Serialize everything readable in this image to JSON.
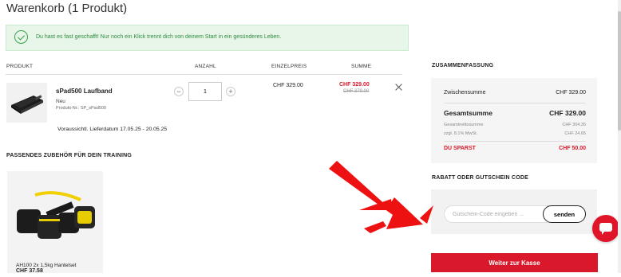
{
  "page": {
    "title": "Warenkorb (1 Produkt)"
  },
  "alert": {
    "message": "Du hast es fast geschafft! Nur noch ein Klick trennt dich von deinem Start in ein gesünderes Leben."
  },
  "cart_table": {
    "headers": {
      "product": "PRODUKT",
      "quantity": "ANZAHL",
      "unit_price": "EINZELPREIS",
      "sum": "SUMME"
    },
    "item": {
      "name": "sPad500 Laufband",
      "condition": "Neu",
      "product_number": "Produkt-Nr.: SP_sPad500",
      "quantity": "1",
      "unit_price": "CHF 329.00",
      "sum": "CHF 329.00",
      "old_sum": "CHF 379.00",
      "delivery": "Voraussichtl. Lieferdatum 17.05.25 - 20.05.25"
    },
    "minus": "−",
    "plus": "+"
  },
  "accessories": {
    "title": "PASSENDES ZUBEHÖR FÜR DEIN TRAINING",
    "items": [
      {
        "name": "AH100 2x 1,5kg Hantelset",
        "price": "CHF 37.58"
      }
    ]
  },
  "summary": {
    "title": "ZUSAMMENFASSUNG",
    "subtotal_label": "Zwischensumme",
    "subtotal_value": "CHF 329.00",
    "total_label": "Gesamtsumme",
    "total_value": "CHF 329.00",
    "net_label": "Gesamtnettosumme",
    "net_value": "CHF 304.35",
    "vat_label": "zzgl. 8.1% MwSt.",
    "vat_value": "CHF 24.65",
    "savings_label": "DU SPARST",
    "savings_value": "CHF 50.00"
  },
  "coupon": {
    "title": "RABATT ODER GUTSCHEIN CODE",
    "placeholder": "Gutschein-Code eingeben ...",
    "button": "senden"
  },
  "checkout": {
    "button": "Weiter zur Kasse"
  },
  "colors": {
    "accent": "#d9182b",
    "success_bg": "#e7f6e9",
    "success_text": "#2f8c3e",
    "arrow": "#ee1111"
  },
  "icons": [
    "check-circle-icon",
    "close-icon",
    "chat-icon",
    "arrow-icon"
  ]
}
